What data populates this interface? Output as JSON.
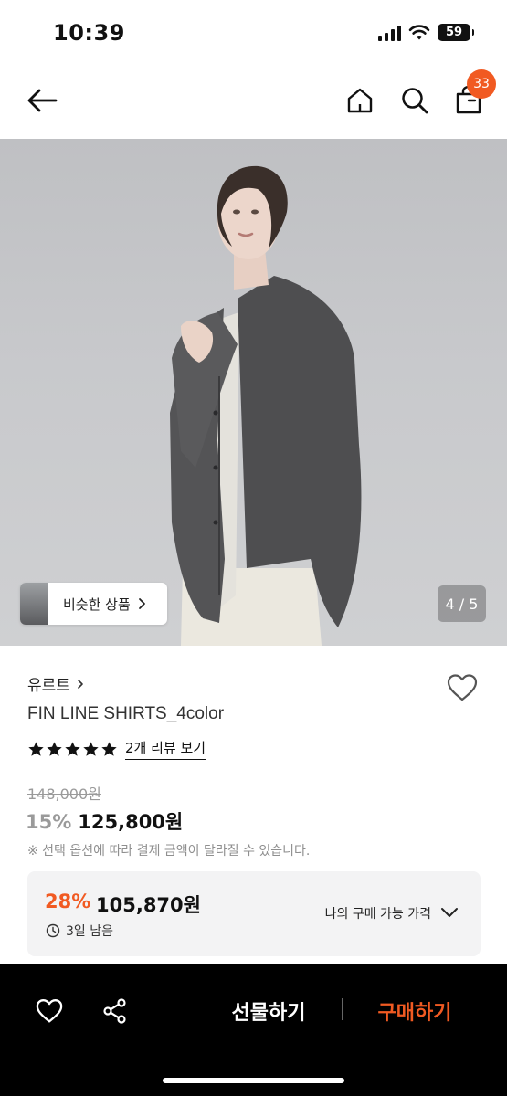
{
  "status_bar": {
    "time": "10:39",
    "battery": "59"
  },
  "nav": {
    "cart_count": "33"
  },
  "gallery": {
    "similar_label": "비슷한 상품",
    "page_indicator": "4 / 5"
  },
  "product": {
    "brand": "유르트",
    "name": "FIN LINE SHIRTS_4color",
    "rating": 5,
    "review_link": "2개 리뷰 보기",
    "original_price": "148,000원",
    "discount_rate": "15%",
    "sale_price": "125,800원",
    "notice": "※ 선택 옵션에 따라 결제 금액이 달라질 수 있습니다."
  },
  "benefit": {
    "rate": "28%",
    "price": "105,870원",
    "time_left": "3일 남음",
    "label": "나의 구매 가능 가격"
  },
  "bottom_bar": {
    "gift_label": "선물하기",
    "buy_label": "구매하기"
  },
  "colors": {
    "accent": "#f15a22",
    "bar_bg": "#000000",
    "muted": "#9a9a9a"
  }
}
